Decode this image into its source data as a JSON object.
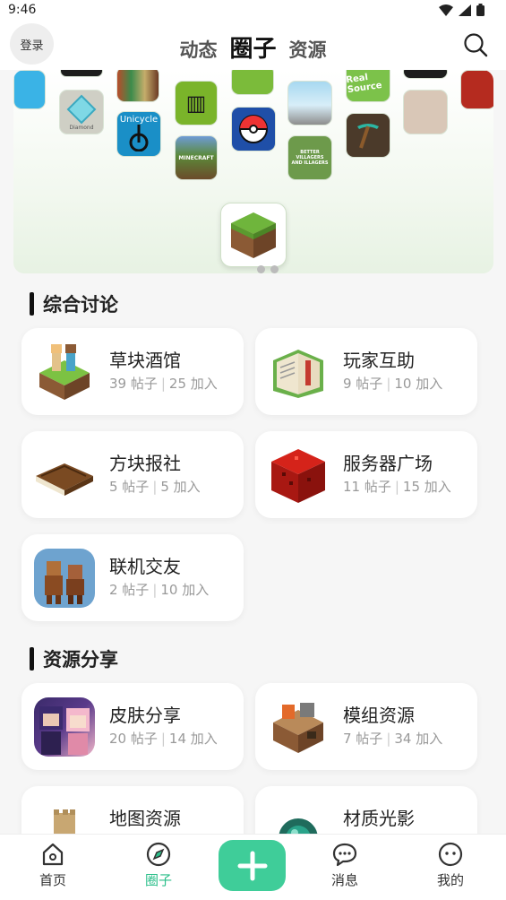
{
  "status": {
    "time": "9:46"
  },
  "header": {
    "login": "登录",
    "tabs": [
      {
        "label": "动态"
      },
      {
        "label": "圈子"
      },
      {
        "label": "资源"
      }
    ]
  },
  "sections": [
    {
      "title": "综合讨论",
      "cards": [
        {
          "name": "草块酒馆",
          "posts": "39 帖子",
          "joined": "25 加入"
        },
        {
          "name": "玩家互助",
          "posts": "9 帖子",
          "joined": "10 加入"
        },
        {
          "name": "方块报社",
          "posts": "5 帖子",
          "joined": "5 加入"
        },
        {
          "name": "服务器广场",
          "posts": "11 帖子",
          "joined": "15 加入"
        },
        {
          "name": "联机交友",
          "posts": "2 帖子",
          "joined": "10 加入"
        }
      ]
    },
    {
      "title": "资源分享",
      "cards": [
        {
          "name": "皮肤分享",
          "posts": "20 帖子",
          "joined": "14 加入"
        },
        {
          "name": "模组资源",
          "posts": "7 帖子",
          "joined": "34 加入"
        },
        {
          "name": "地图资源",
          "posts": "",
          "joined": ""
        },
        {
          "name": "材质光影",
          "posts": "",
          "joined": ""
        }
      ]
    }
  ],
  "banner_labels": {
    "unicycle": "Unicycle",
    "realsource": "Real Source",
    "minecraft": "MINECRAFT",
    "villagers": "BETTER VILLAGERS AND ILLAGERS",
    "diamond": "Diamond"
  },
  "nav": [
    {
      "label": "首页"
    },
    {
      "label": "圈子"
    },
    {
      "label": "消息"
    },
    {
      "label": "我的"
    }
  ],
  "colors": {
    "accent": "#3fcd99",
    "active_tab": "#2bbf8a"
  }
}
